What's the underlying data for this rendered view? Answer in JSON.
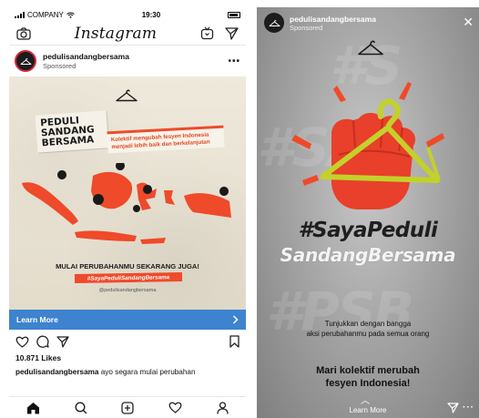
{
  "feed": {
    "status": {
      "carrier": "COMPANY",
      "time": "19:30"
    },
    "header": {
      "logo": "Instagram"
    },
    "post": {
      "username": "pedulisandangbersama",
      "sponsored": "Sponsored",
      "image": {
        "title_lines": [
          "PEDULI",
          "SANDANG",
          "BERSAMA"
        ],
        "tagline_lines": [
          "Kolektif mengubah fesyen Indonesia",
          "menjadi lebih baik dan berkelanjutan"
        ],
        "cta": "MULAI PERUBAHANMU SEKARANG JUGA!",
        "hashtag": "#SayaPeduliSandangBersama",
        "handle": "@pedulisandangbersama"
      },
      "learn_more": "Learn More",
      "likes": "10.871 Likes",
      "caption_user": "pedulisandangbersama",
      "caption_text": " ayo segara mulai perubahan"
    },
    "icons": [
      "camera-icon",
      "igtv-icon",
      "send-icon",
      "heart-icon",
      "comment-icon",
      "share-icon",
      "bookmark-icon",
      "home-icon",
      "search-icon",
      "add-icon",
      "activity-icon",
      "profile-icon"
    ]
  },
  "story": {
    "username": "pedulisandangbersama",
    "sponsored": "Sponsored",
    "hashtag_line1": "#SayaPeduli",
    "hashtag_line2": "SandangBersama",
    "sub_lines": [
      "Tunjukkan dengan bangga",
      "aksi perubahanmu pada semua orang"
    ],
    "bold_lines": [
      "Mari kolektif merubah",
      "fesyen Indonesia!"
    ],
    "learn_more": "Learn More"
  },
  "colors": {
    "accent_red": "#ef4a2a",
    "link_blue": "#3e83d0",
    "hanger_green": "#c3d12a"
  }
}
